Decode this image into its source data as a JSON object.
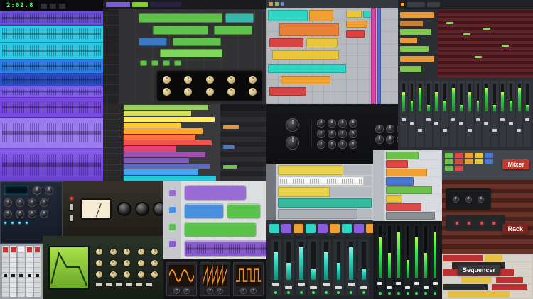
{
  "transport": {
    "lcd_time": "2:02.8"
  },
  "reason": {
    "mixer_label": "Mixer",
    "rack_label": "Rack",
    "sequencer_label": "Sequencer"
  },
  "palette": {
    "lcd_green": "#4aff6a",
    "mixer_label_red": "#c0392b",
    "rack_label_maroon": "#7a241e",
    "sequencer_label_gray": "#3a3a3e",
    "waveform_cyan": "#2fc9e6",
    "waveform_purple": "#8a5cf0",
    "clip_green": "#5fc24a",
    "clip_orange": "#f0a030",
    "clip_red": "#d84444",
    "clip_yellow": "#e8c83a",
    "clip_teal": "#2fd6c3",
    "meter_green": "#35d04a"
  }
}
